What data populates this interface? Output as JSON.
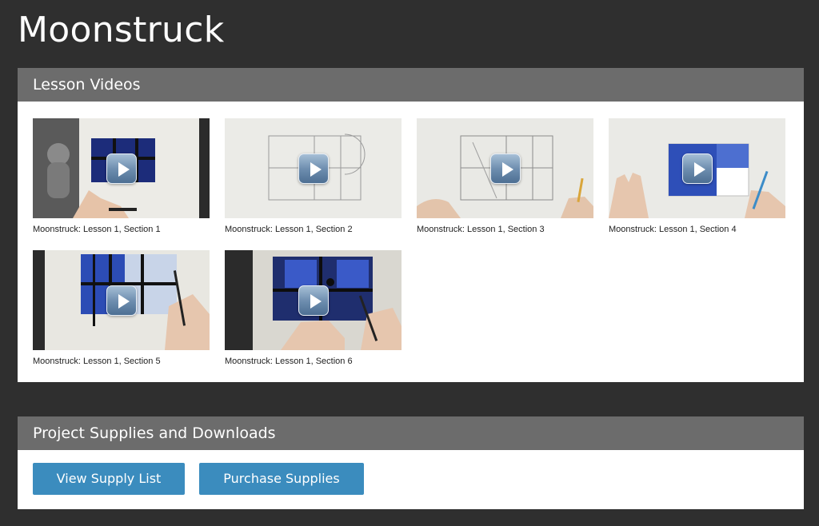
{
  "page": {
    "title": "Moonstruck"
  },
  "videos_section": {
    "title": "Lesson Videos",
    "videos": [
      {
        "caption": "Moonstruck: Lesson 1, Section 1"
      },
      {
        "caption": "Moonstruck: Lesson 1, Section 2"
      },
      {
        "caption": "Moonstruck: Lesson 1, Section 3"
      },
      {
        "caption": "Moonstruck: Lesson 1, Section 4"
      },
      {
        "caption": "Moonstruck: Lesson 1, Section 5"
      },
      {
        "caption": "Moonstruck: Lesson 1, Section 6"
      }
    ]
  },
  "supplies_section": {
    "title": "Project Supplies and Downloads",
    "view_supply_list": "View Supply List",
    "purchase_supplies": "Purchase Supplies"
  },
  "colors": {
    "background": "#2f2f2f",
    "panel_header": "#6c6c6c",
    "button": "#3b8cbe"
  },
  "icons": {
    "play": "play-icon"
  }
}
